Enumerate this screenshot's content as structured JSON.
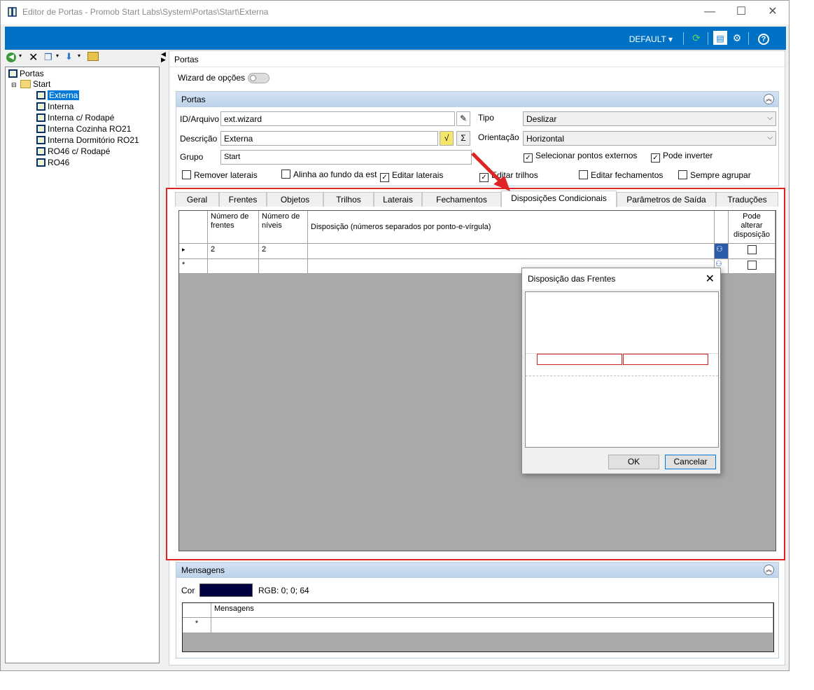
{
  "window": {
    "title": "Editor de Portas - Promob Start Labs\\System\\Portas\\Start\\Externa",
    "minimize": "—",
    "maximize": "☐",
    "close": "✕"
  },
  "toolbar": {
    "profile": "DEFAULT",
    "profile_arrow": "▾"
  },
  "tree": {
    "root": "Portas",
    "folder": "Start",
    "items": [
      "Externa",
      "Interna",
      "Interna c/ Rodapé",
      "Interna Cozinha RO21",
      "Interna Dormitório RO21",
      "RO46 c/ Rodapé",
      "RO46"
    ]
  },
  "main": {
    "header": "Portas",
    "wizard_label": "Wizard de opções",
    "group_title": "Portas",
    "id_label": "ID/Arquivo",
    "id_value": "ext.wizard",
    "desc_label": "Descrição",
    "desc_value": "Externa",
    "grupo_label": "Grupo",
    "grupo_value": "Start",
    "tipo_label": "Tipo",
    "tipo_value": "Deslizar",
    "orient_label": "Orientação",
    "orient_value": "Horizontal",
    "sigma": "Σ",
    "checks": {
      "selecionar": {
        "label": "Selecionar pontos externos",
        "checked": true
      },
      "inverter": {
        "label": "Pode inverter",
        "checked": true
      },
      "remover": {
        "label": "Remover laterais",
        "checked": false
      },
      "alinha": {
        "label": "Alinha ao fundo da est",
        "checked": false
      },
      "editar_laterais": {
        "label": "Editar laterais",
        "checked": true
      },
      "trilhos": {
        "label": "Editar trilhos",
        "checked": true
      },
      "fechamentos": {
        "label": "Editar fechamentos",
        "checked": false
      },
      "agrupar": {
        "label": "Sempre agrupar",
        "checked": false
      }
    }
  },
  "tabs": [
    "Geral",
    "Frentes",
    "Objetos",
    "Trilhos",
    "Laterais",
    "Fechamentos",
    "Disposições Condicionais",
    "Parâmetros de Saída",
    "Traduções"
  ],
  "active_tab": "Disposições Condicionais",
  "grid": {
    "headers": [
      "Número de frentes",
      "Número de níveis",
      "Disposição (números separados por ponto-e-vírgula)",
      "",
      "Pode alterar disposição"
    ],
    "rows": [
      {
        "marker": "▸",
        "frentes": "2",
        "niveis": "2",
        "disposicao": "",
        "pode": false
      },
      {
        "marker": "*",
        "frentes": "",
        "niveis": "",
        "disposicao": "",
        "pode": false
      }
    ]
  },
  "dialog": {
    "title": "Disposição das Frentes",
    "ok": "OK",
    "cancel": "Cancelar"
  },
  "messages": {
    "title": "Mensagens",
    "cor_label": "Cor",
    "cor_value": "RGB: 0; 0; 64",
    "cor_hex": "#000040",
    "col_header": "Mensagens",
    "new_row_marker": "*"
  },
  "colors": {
    "accent": "#0072c6",
    "highlight": "#e02424"
  }
}
